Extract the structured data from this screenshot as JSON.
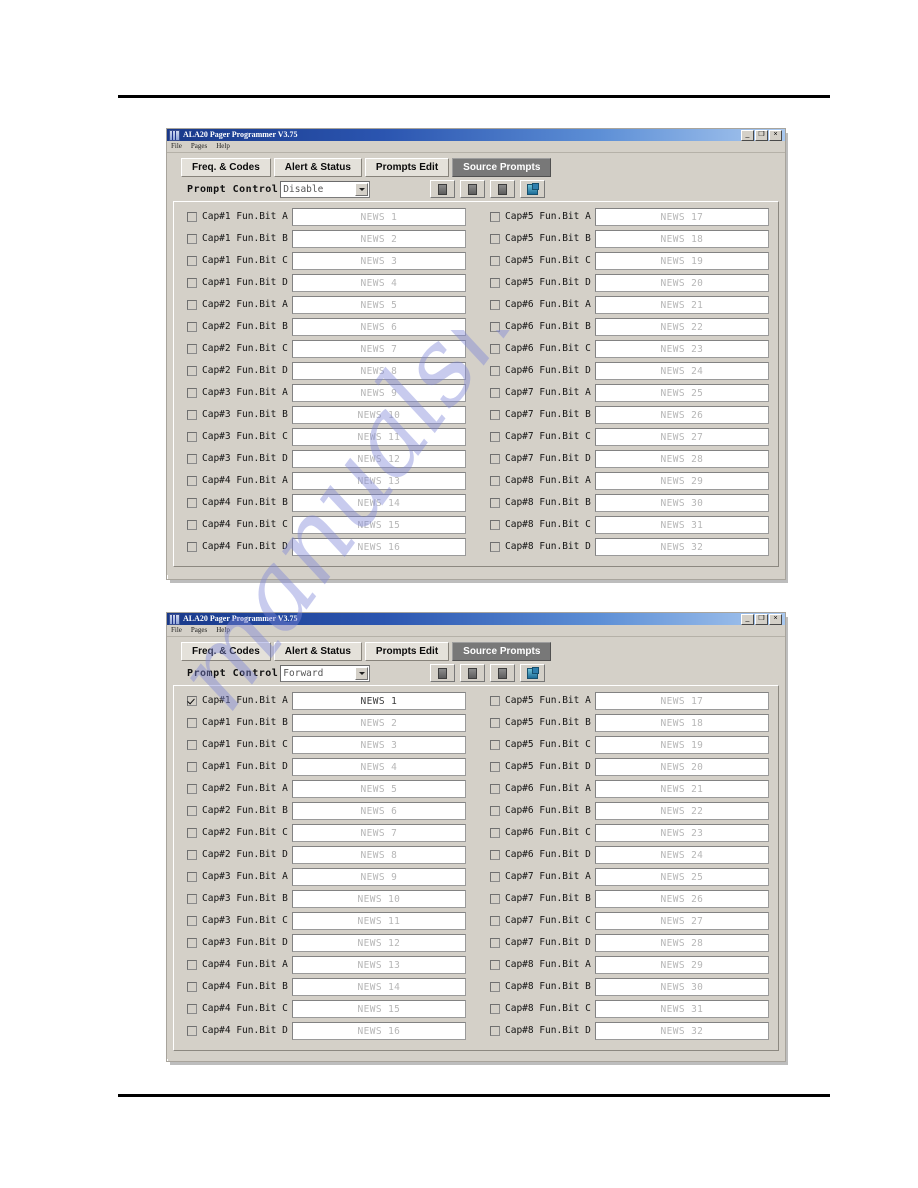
{
  "watermark": {
    "text": "manualshive.com",
    "color": "#7e86d8"
  },
  "window": {
    "title": "ALA20 Pager Programmer V3.75",
    "titlebar_buttons": [
      "_",
      "❐",
      "×"
    ],
    "menu": [
      "File",
      "Pages",
      "Help"
    ],
    "tabs": [
      {
        "label": "Freq. & Codes",
        "active": false
      },
      {
        "label": "Alert & Status",
        "active": false
      },
      {
        "label": "Prompts Edit",
        "active": false
      },
      {
        "label": "Source Prompts",
        "active": true
      }
    ],
    "prompt_control_label": "Prompt Control",
    "toolbar_icons": [
      "save-icon",
      "save-icon",
      "save-icon",
      "export-icon"
    ]
  },
  "screens": [
    {
      "id": "screen-top",
      "prompt_control_value": "Disable",
      "left_rows": [
        {
          "label": "Cap#1 Fun.Bit A",
          "value": "NEWS 1",
          "checked": false
        },
        {
          "label": "Cap#1 Fun.Bit B",
          "value": "NEWS 2",
          "checked": false
        },
        {
          "label": "Cap#1 Fun.Bit C",
          "value": "NEWS 3",
          "checked": false
        },
        {
          "label": "Cap#1 Fun.Bit D",
          "value": "NEWS 4",
          "checked": false
        },
        {
          "label": "Cap#2 Fun.Bit A",
          "value": "NEWS 5",
          "checked": false
        },
        {
          "label": "Cap#2 Fun.Bit B",
          "value": "NEWS 6",
          "checked": false
        },
        {
          "label": "Cap#2 Fun.Bit C",
          "value": "NEWS 7",
          "checked": false
        },
        {
          "label": "Cap#2 Fun.Bit D",
          "value": "NEWS 8",
          "checked": false
        },
        {
          "label": "Cap#3 Fun.Bit A",
          "value": "NEWS 9",
          "checked": false
        },
        {
          "label": "Cap#3 Fun.Bit B",
          "value": "NEWS 10",
          "checked": false
        },
        {
          "label": "Cap#3 Fun.Bit C",
          "value": "NEWS 11",
          "checked": false
        },
        {
          "label": "Cap#3 Fun.Bit D",
          "value": "NEWS 12",
          "checked": false
        },
        {
          "label": "Cap#4 Fun.Bit A",
          "value": "NEWS 13",
          "checked": false
        },
        {
          "label": "Cap#4 Fun.Bit B",
          "value": "NEWS 14",
          "checked": false
        },
        {
          "label": "Cap#4 Fun.Bit C",
          "value": "NEWS 15",
          "checked": false
        },
        {
          "label": "Cap#4 Fun.Bit D",
          "value": "NEWS 16",
          "checked": false
        }
      ],
      "right_rows": [
        {
          "label": "Cap#5 Fun.Bit A",
          "value": "NEWS 17",
          "checked": false
        },
        {
          "label": "Cap#5 Fun.Bit B",
          "value": "NEWS 18",
          "checked": false
        },
        {
          "label": "Cap#5 Fun.Bit C",
          "value": "NEWS 19",
          "checked": false
        },
        {
          "label": "Cap#5 Fun.Bit D",
          "value": "NEWS 20",
          "checked": false
        },
        {
          "label": "Cap#6 Fun.Bit A",
          "value": "NEWS 21",
          "checked": false
        },
        {
          "label": "Cap#6 Fun.Bit B",
          "value": "NEWS 22",
          "checked": false
        },
        {
          "label": "Cap#6 Fun.Bit C",
          "value": "NEWS 23",
          "checked": false
        },
        {
          "label": "Cap#6 Fun.Bit D",
          "value": "NEWS 24",
          "checked": false
        },
        {
          "label": "Cap#7 Fun.Bit A",
          "value": "NEWS 25",
          "checked": false
        },
        {
          "label": "Cap#7 Fun.Bit B",
          "value": "NEWS 26",
          "checked": false
        },
        {
          "label": "Cap#7 Fun.Bit C",
          "value": "NEWS 27",
          "checked": false
        },
        {
          "label": "Cap#7 Fun.Bit D",
          "value": "NEWS 28",
          "checked": false
        },
        {
          "label": "Cap#8 Fun.Bit A",
          "value": "NEWS 29",
          "checked": false
        },
        {
          "label": "Cap#8 Fun.Bit B",
          "value": "NEWS 30",
          "checked": false
        },
        {
          "label": "Cap#8 Fun.Bit C",
          "value": "NEWS 31",
          "checked": false
        },
        {
          "label": "Cap#8 Fun.Bit D",
          "value": "NEWS 32",
          "checked": false
        }
      ]
    },
    {
      "id": "screen-bottom",
      "prompt_control_value": "Forward",
      "left_rows": [
        {
          "label": "Cap#1 Fun.Bit A",
          "value": "NEWS 1",
          "checked": true
        },
        {
          "label": "Cap#1 Fun.Bit B",
          "value": "NEWS 2",
          "checked": false
        },
        {
          "label": "Cap#1 Fun.Bit C",
          "value": "NEWS 3",
          "checked": false
        },
        {
          "label": "Cap#1 Fun.Bit D",
          "value": "NEWS 4",
          "checked": false
        },
        {
          "label": "Cap#2 Fun.Bit A",
          "value": "NEWS 5",
          "checked": false
        },
        {
          "label": "Cap#2 Fun.Bit B",
          "value": "NEWS 6",
          "checked": false
        },
        {
          "label": "Cap#2 Fun.Bit C",
          "value": "NEWS 7",
          "checked": false
        },
        {
          "label": "Cap#2 Fun.Bit D",
          "value": "NEWS 8",
          "checked": false
        },
        {
          "label": "Cap#3 Fun.Bit A",
          "value": "NEWS 9",
          "checked": false
        },
        {
          "label": "Cap#3 Fun.Bit B",
          "value": "NEWS 10",
          "checked": false
        },
        {
          "label": "Cap#3 Fun.Bit C",
          "value": "NEWS 11",
          "checked": false
        },
        {
          "label": "Cap#3 Fun.Bit D",
          "value": "NEWS 12",
          "checked": false
        },
        {
          "label": "Cap#4 Fun.Bit A",
          "value": "NEWS 13",
          "checked": false
        },
        {
          "label": "Cap#4 Fun.Bit B",
          "value": "NEWS 14",
          "checked": false
        },
        {
          "label": "Cap#4 Fun.Bit C",
          "value": "NEWS 15",
          "checked": false
        },
        {
          "label": "Cap#4 Fun.Bit D",
          "value": "NEWS 16",
          "checked": false
        }
      ],
      "right_rows": [
        {
          "label": "Cap#5 Fun.Bit A",
          "value": "NEWS 17",
          "checked": false
        },
        {
          "label": "Cap#5 Fun.Bit B",
          "value": "NEWS 18",
          "checked": false
        },
        {
          "label": "Cap#5 Fun.Bit C",
          "value": "NEWS 19",
          "checked": false
        },
        {
          "label": "Cap#5 Fun.Bit D",
          "value": "NEWS 20",
          "checked": false
        },
        {
          "label": "Cap#6 Fun.Bit A",
          "value": "NEWS 21",
          "checked": false
        },
        {
          "label": "Cap#6 Fun.Bit B",
          "value": "NEWS 22",
          "checked": false
        },
        {
          "label": "Cap#6 Fun.Bit C",
          "value": "NEWS 23",
          "checked": false
        },
        {
          "label": "Cap#6 Fun.Bit D",
          "value": "NEWS 24",
          "checked": false
        },
        {
          "label": "Cap#7 Fun.Bit A",
          "value": "NEWS 25",
          "checked": false
        },
        {
          "label": "Cap#7 Fun.Bit B",
          "value": "NEWS 26",
          "checked": false
        },
        {
          "label": "Cap#7 Fun.Bit C",
          "value": "NEWS 27",
          "checked": false
        },
        {
          "label": "Cap#7 Fun.Bit D",
          "value": "NEWS 28",
          "checked": false
        },
        {
          "label": "Cap#8 Fun.Bit A",
          "value": "NEWS 29",
          "checked": false
        },
        {
          "label": "Cap#8 Fun.Bit B",
          "value": "NEWS 30",
          "checked": false
        },
        {
          "label": "Cap#8 Fun.Bit C",
          "value": "NEWS 31",
          "checked": false
        },
        {
          "label": "Cap#8 Fun.Bit D",
          "value": "NEWS 32",
          "checked": false
        }
      ]
    }
  ]
}
